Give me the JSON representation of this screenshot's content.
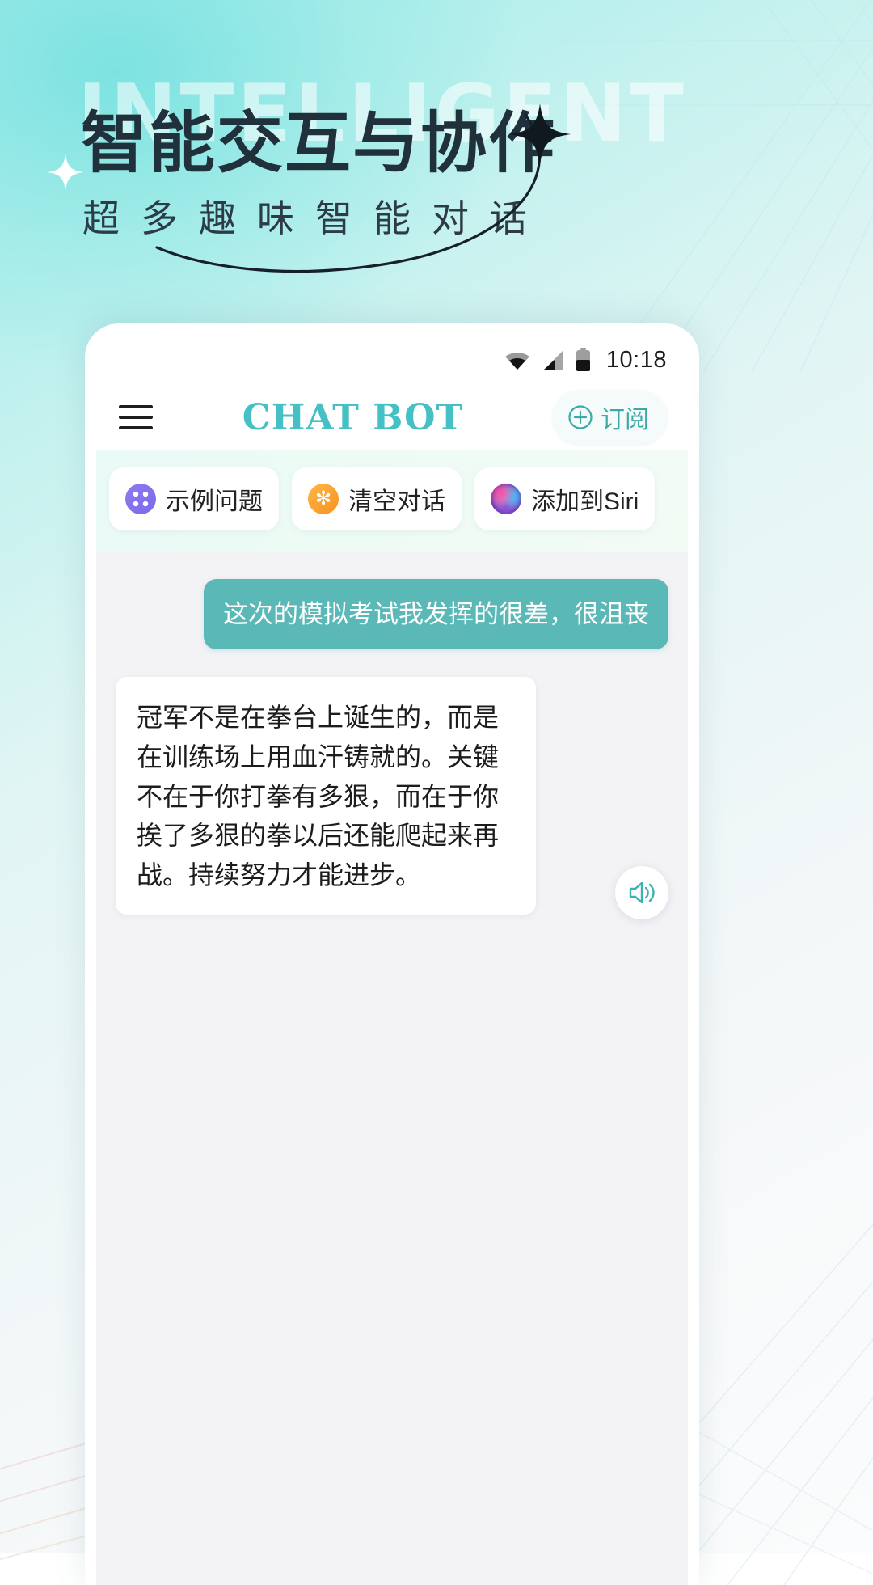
{
  "hero": {
    "watermark": "INTELLIGENT",
    "headline": "智能交互与协作",
    "subline": "超多趣味智能对话"
  },
  "phone": {
    "statusbar": {
      "time": "10:18",
      "icons": [
        "wifi-icon",
        "cellular-signal-icon",
        "battery-icon"
      ]
    },
    "appbar": {
      "menu_icon": "hamburger-menu-icon",
      "brand": "CHAT BOT",
      "subscribe": {
        "icon": "plus-circle-icon",
        "label": "订阅"
      }
    },
    "chips": [
      {
        "icon": "grid-dots-icon",
        "label": "示例问题"
      },
      {
        "icon": "broom-clear-icon",
        "label": "清空对话"
      },
      {
        "icon": "siri-orb-icon",
        "label": "添加到Siri"
      }
    ],
    "chat": {
      "user_message": "这次的模拟考试我发挥的很差，很沮丧",
      "bot_message": "冠军不是在拳台上诞生的，而是在训练场上用血汗铸就的。关键不在于你打拳有多狠，而在于你挨了多狠的拳以后还能爬起来再战。持续努力才能进步。",
      "speaker_icon": "speaker-volume-icon"
    }
  },
  "colors": {
    "brand_teal": "#45c0c4",
    "bubble_teal": "#5ab9b7",
    "subscribe_teal": "#3eaaa8",
    "headline_dark": "#21313c",
    "bg_top": "#9ce9e8"
  }
}
